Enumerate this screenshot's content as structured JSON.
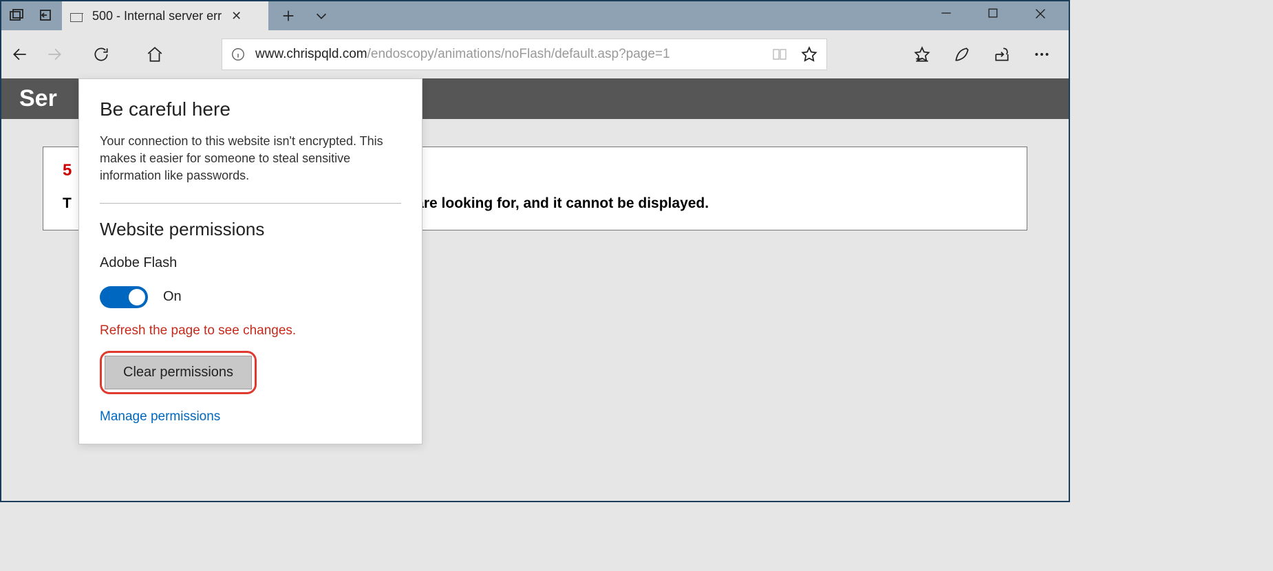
{
  "tab": {
    "title": "500 - Internal server err"
  },
  "url": {
    "dark": "www.chrispqld.com",
    "rest": "/endoscopy/animations/noFlash/default.asp?page=1"
  },
  "band": {
    "title_fragment": "Ser"
  },
  "error": {
    "line1_fragment": "5",
    "line2_prefix": "T",
    "line2_visible": "u are looking for, and it cannot be displayed."
  },
  "flyout": {
    "heading": "Be careful here",
    "paragraph": "Your connection to this website isn't encrypted. This makes it easier for someone to steal sensitive information like passwords.",
    "section": "Website permissions",
    "perm_name": "Adobe Flash",
    "toggle_state": "On",
    "refresh_hint": "Refresh the page to see changes.",
    "clear_label": "Clear permissions",
    "manage_label": "Manage permissions"
  }
}
